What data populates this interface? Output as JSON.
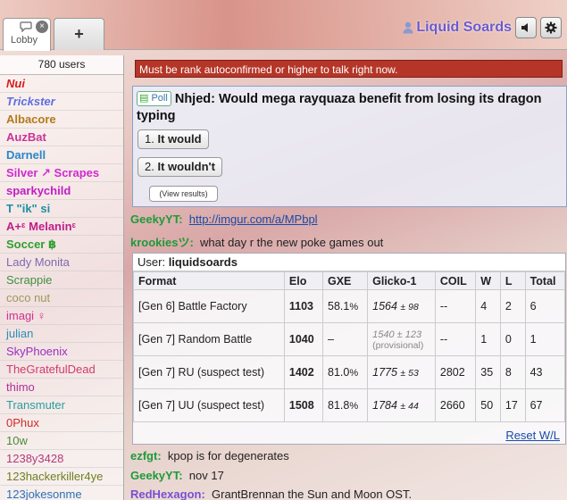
{
  "tabs": {
    "lobby_label": "Lobby",
    "close_glyph": "×",
    "add_glyph": "+"
  },
  "user": {
    "name": "Liquid Soards",
    "sound_icon": "speaker-icon",
    "settings_icon": "gear-icon"
  },
  "userlist": {
    "count_label": "780 users",
    "users": [
      {
        "name": "Nui",
        "color": "#d81b1b",
        "style": "bi"
      },
      {
        "name": "Trickster",
        "color": "#5f6ee0",
        "style": "bi"
      },
      {
        "name": "Albacore",
        "color": "#b37a1a",
        "style": "b"
      },
      {
        "name": "AuzBat",
        "color": "#c8349a",
        "style": "b"
      },
      {
        "name": "Darnell",
        "color": "#2a87c9",
        "style": "b"
      },
      {
        "name": "Silver ↗ Scrapes",
        "color": "#d02ad0",
        "style": "b"
      },
      {
        "name": "sparkychild",
        "color": "#c21cc6",
        "style": "b"
      },
      {
        "name": "T \"ik\" si",
        "color": "#1c8fa3",
        "style": "b"
      },
      {
        "name": "A+ᵋ Melaninᵋ",
        "color": "#c01e8a",
        "style": "b"
      },
      {
        "name": "Soccer ฿",
        "color": "#2e9f2e",
        "style": "b"
      },
      {
        "name": "Lady Monita",
        "color": "#7c6bb0",
        "style": ""
      },
      {
        "name": "Scrappie",
        "color": "#3f8f3f",
        "style": ""
      },
      {
        "name": "coco nut",
        "color": "#9a9a5a",
        "style": ""
      },
      {
        "name": "imagi ♀",
        "color": "#d0308f",
        "style": ""
      },
      {
        "name": "julian",
        "color": "#2b8fb5",
        "style": ""
      },
      {
        "name": "SkyPhoenix",
        "color": "#9a2fc0",
        "style": ""
      },
      {
        "name": "TheGratefulDead",
        "color": "#d03b6d",
        "style": ""
      },
      {
        "name": "thimo",
        "color": "#b0309b",
        "style": ""
      },
      {
        "name": "Transmuter",
        "color": "#2a9e9e",
        "style": ""
      },
      {
        "name": "0Phux",
        "color": "#d02b2b",
        "style": ""
      },
      {
        "name": "10w",
        "color": "#4a8a3a",
        "style": ""
      },
      {
        "name": "1238y3428",
        "color": "#b5387a",
        "style": ""
      },
      {
        "name": "123hackerkiller4ye",
        "color": "#6f7f1f",
        "style": ""
      },
      {
        "name": "123jokesonme",
        "color": "#2d6fb5",
        "style": ""
      }
    ]
  },
  "chat": {
    "warning": "Must be rank autoconfirmed or higher to talk right now.",
    "poll": {
      "tag": "Poll",
      "question": "Nhjed: Would mega rayquaza benefit from losing its dragon typing",
      "options": [
        {
          "num": "1.",
          "label": "It would"
        },
        {
          "num": "2.",
          "label": "It wouldn't"
        }
      ],
      "view_results": "(View results)"
    },
    "messages_top": [
      {
        "user": "GeekyYT:",
        "color": "#1e9a3a",
        "text": "http://imgur.com/a/MPbpl",
        "link": true
      },
      {
        "user": "krookiesツ:",
        "color": "#1e9a3a",
        "text": "what day r the new poke games out",
        "link": false
      }
    ],
    "ranks": {
      "user_label": "User:",
      "user_name": "liquidsoards",
      "headers": [
        "Format",
        "Elo",
        "GXE",
        "Glicko-1",
        "COIL",
        "W",
        "L",
        "Total"
      ],
      "rows": [
        {
          "format": "[Gen 6] Battle Factory",
          "elo": "1103",
          "gxe": "58.1",
          "pct": "%",
          "glicko": "1564",
          "dev": "± 98",
          "provisional": false,
          "coil": "--",
          "w": "4",
          "l": "2",
          "total": "6"
        },
        {
          "format": "[Gen 7] Random Battle",
          "elo": "1040",
          "gxe": "–",
          "pct": "",
          "glicko": "1540",
          "dev": "± 123",
          "provisional": true,
          "prov_note": "(provisional)",
          "coil": "--",
          "w": "1",
          "l": "0",
          "total": "1"
        },
        {
          "format": "[Gen 7] RU (suspect test)",
          "elo": "1402",
          "gxe": "81.0",
          "pct": "%",
          "glicko": "1775",
          "dev": "± 53",
          "provisional": false,
          "coil": "2802",
          "w": "35",
          "l": "8",
          "total": "43"
        },
        {
          "format": "[Gen 7] UU (suspect test)",
          "elo": "1508",
          "gxe": "81.8",
          "pct": "%",
          "glicko": "1784",
          "dev": "± 44",
          "provisional": false,
          "coil": "2660",
          "w": "50",
          "l": "17",
          "total": "67"
        }
      ],
      "reset_label": "Reset W/L"
    },
    "messages_bottom": [
      {
        "user": "ezfgt:",
        "color": "#1e9a3a",
        "text": "kpop is for degenerates"
      },
      {
        "user": "GeekyYT:",
        "color": "#1e9a3a",
        "text": "nov 17"
      },
      {
        "user": "RedHexagon:",
        "color": "#7a4fd0",
        "text": "GrantBrennan the Sun and Moon OST."
      }
    ]
  }
}
